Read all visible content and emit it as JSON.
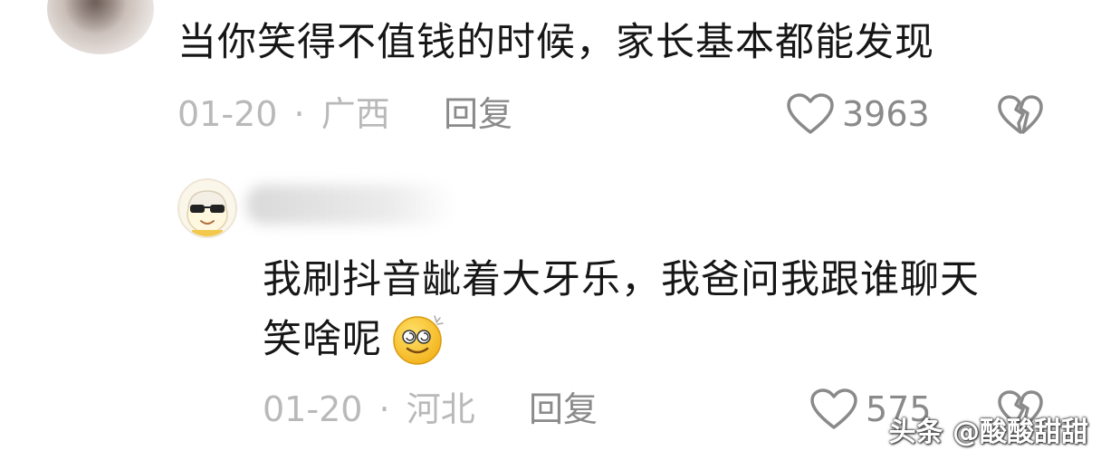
{
  "comment": {
    "text": "当你笑得不值钱的时候，家长基本都能发现",
    "date": "01-20",
    "separator": "·",
    "location": "广西",
    "reply_label": "回复",
    "likes": "3963",
    "like_icon": "heart-outline-icon",
    "dislike_icon": "broken-heart-icon"
  },
  "reply_comment": {
    "text_line1": "我刷抖音龇着大牙乐，我爸问我跟谁聊天",
    "text_line2": "笑啥呢",
    "emoji": "dizzy-smile-emoji",
    "date": "01-20",
    "separator": "·",
    "location": "河北",
    "reply_label": "回复",
    "likes": "575",
    "like_icon": "heart-outline-icon",
    "dislike_icon": "broken-heart-icon"
  },
  "watermark": {
    "brand": "头条",
    "handle": "@酸酸甜甜"
  }
}
